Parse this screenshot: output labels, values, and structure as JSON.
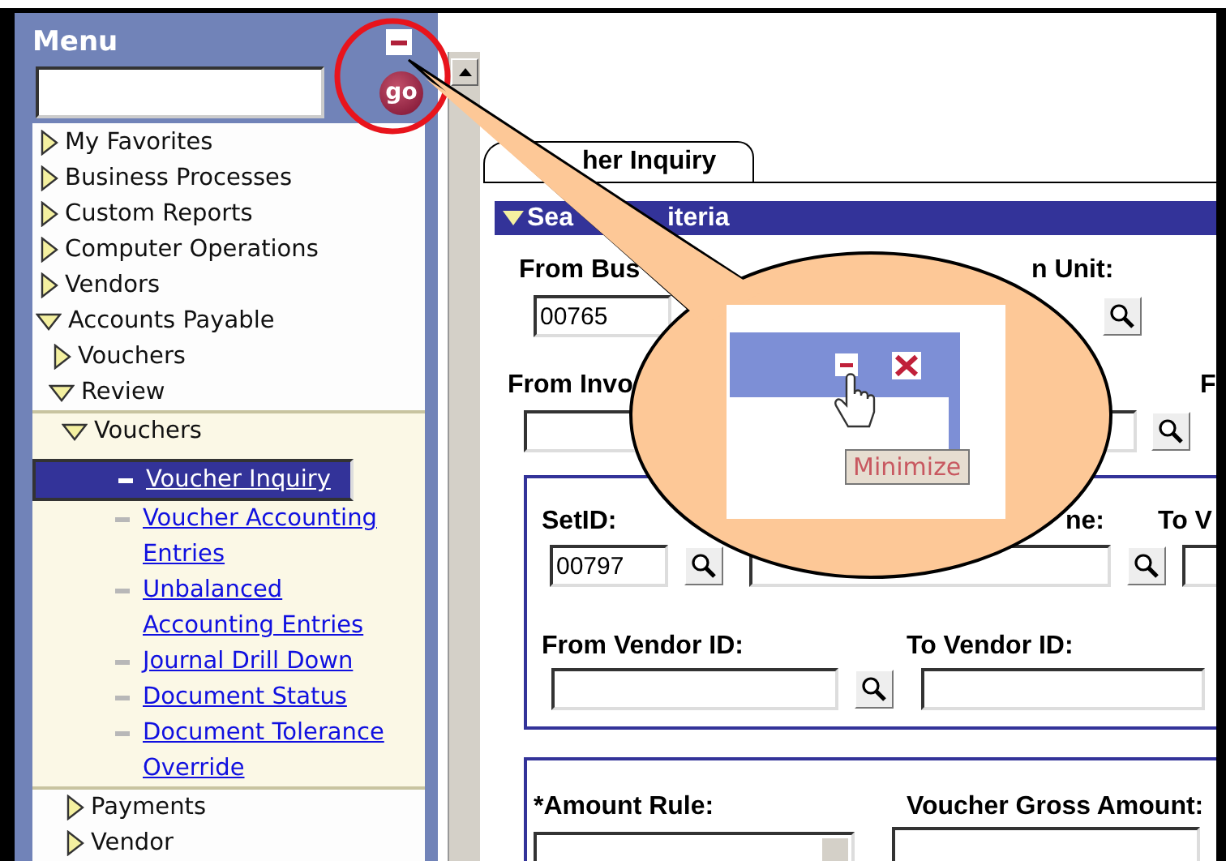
{
  "menu": {
    "title": "Menu",
    "go_label": "go",
    "items": [
      {
        "label": "My Favorites",
        "expanded": false
      },
      {
        "label": "Business Processes",
        "expanded": false
      },
      {
        "label": "Custom Reports",
        "expanded": false
      },
      {
        "label": "Computer Operations",
        "expanded": false
      },
      {
        "label": "Vendors",
        "expanded": false
      },
      {
        "label": "Accounts Payable",
        "expanded": true,
        "children": [
          {
            "label": "Vouchers",
            "expanded": false
          },
          {
            "label": "Review",
            "expanded": true,
            "children": [
              {
                "label": "Vouchers",
                "expanded": true,
                "children": [
                  {
                    "kind": "link",
                    "label": "Voucher Inquiry",
                    "selected": true
                  },
                  {
                    "kind": "link",
                    "label": "Voucher Accounting Entries",
                    "selected": false
                  },
                  {
                    "kind": "link",
                    "label": "Unbalanced Accounting Entries",
                    "selected": false
                  },
                  {
                    "kind": "link",
                    "label": "Journal Drill Down",
                    "selected": false
                  },
                  {
                    "kind": "link",
                    "label": "Document Status",
                    "selected": false
                  },
                  {
                    "kind": "link",
                    "label": "Document Tolerance Override",
                    "selected": false
                  }
                ]
              },
              {
                "label": "Payments",
                "expanded": false
              },
              {
                "label": "Vendor",
                "expanded": false
              }
            ]
          }
        ]
      }
    ]
  },
  "tab": {
    "label": "her Inquiry",
    "selected": true
  },
  "section": {
    "title_parts": [
      "Sea",
      "iteria"
    ],
    "expanded": true
  },
  "business_unit_row": {
    "label_left": "From Bus",
    "label_right": "n Unit:",
    "value": "00765"
  },
  "invoice_row": {
    "label_left": "From Invo",
    "label_right": "F"
  },
  "vendor_group": {
    "setid_label": "SetID:",
    "setid_value": "00797",
    "name_label": "ne:",
    "to_label": "To V",
    "from_vendor_label": "From Vendor ID:",
    "to_vendor_label": "To Vendor ID:"
  },
  "amount_group": {
    "amount_rule_label": "*Amount Rule:",
    "gross_label": "Voucher Gross Amount:"
  },
  "callout": {
    "tooltip": "Minimize"
  }
}
